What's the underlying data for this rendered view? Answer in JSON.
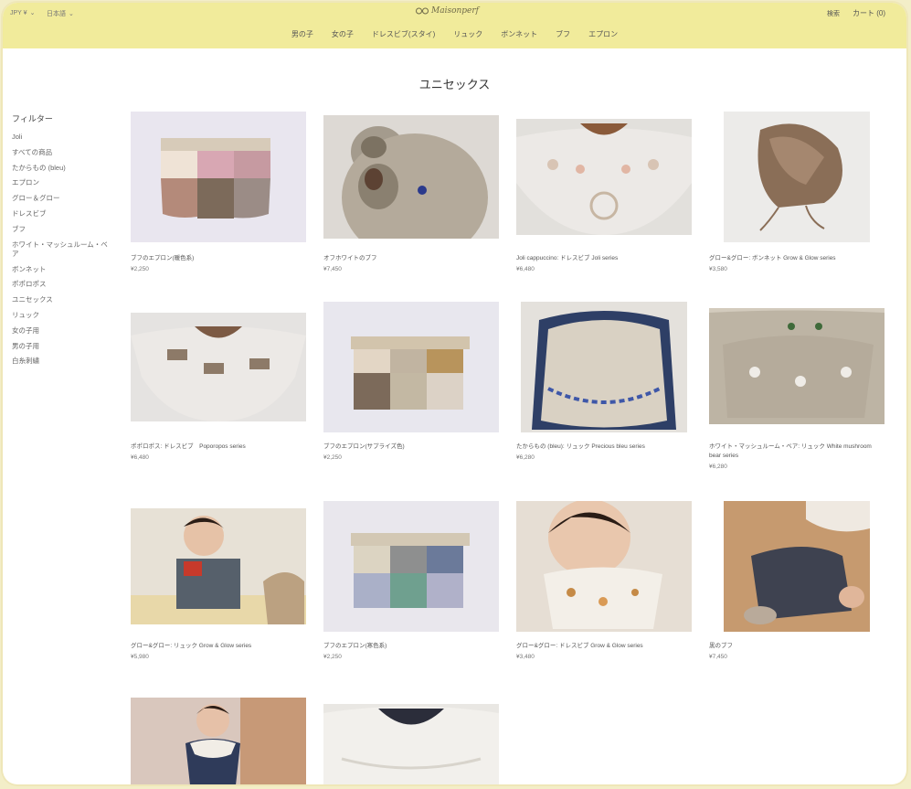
{
  "header": {
    "currency": "JPY ¥",
    "language": "日本語",
    "logo_text": "Maisonperf",
    "search": "検索",
    "cart": "カート (0)",
    "nav": [
      "男の子",
      "女の子",
      "ドレスビブ(スタイ)",
      "リュック",
      "ボンネット",
      "ブフ",
      "エプロン"
    ]
  },
  "page": {
    "title": "ユニセックス"
  },
  "filter": {
    "title": "フィルター",
    "items": [
      "Joli",
      "すべての商品",
      "たからもの (bleu)",
      "エプロン",
      "グロー＆グロー",
      "ドレスビブ",
      "ブフ",
      "ホワイト・マッシュルーム・ベア",
      "ボンネット",
      "ポポロポス",
      "ユニセックス",
      "リュック",
      "女の子用",
      "男の子用",
      "白糸刺繍"
    ]
  },
  "products": [
    {
      "name": "ブフのエプロン(暖色系)",
      "price": "¥2,250"
    },
    {
      "name": "オフホワイトのブフ",
      "price": "¥7,450"
    },
    {
      "name": "Joli cappuccino: ドレスビブ Joli series",
      "price": "¥6,480"
    },
    {
      "name": "グロー&グロー: ボンネット Grow & Glow series",
      "price": "¥3,580"
    },
    {
      "name": "ポポロポス: ドレスビブ　Poporopos series",
      "price": "¥6,480"
    },
    {
      "name": "ブフのエプロン(サプライズ色)",
      "price": "¥2,250"
    },
    {
      "name": "たからもの (bleu): リュック Precious bleu series",
      "price": "¥6,280"
    },
    {
      "name": "ホワイト・マッシュルーム・ベア: リュック White mushroom bear series",
      "price": "¥6,280"
    },
    {
      "name": "グロー&グロー: リュック Grow & Glow series",
      "price": "¥5,980"
    },
    {
      "name": "ブフのエプロン(寒色系)",
      "price": "¥2,250"
    },
    {
      "name": "グロー&グロー: ドレスビブ Grow & Glow series",
      "price": "¥3,480"
    },
    {
      "name": "黒のブフ",
      "price": "¥7,450"
    },
    {
      "name": "",
      "price": ""
    },
    {
      "name": "",
      "price": ""
    }
  ]
}
